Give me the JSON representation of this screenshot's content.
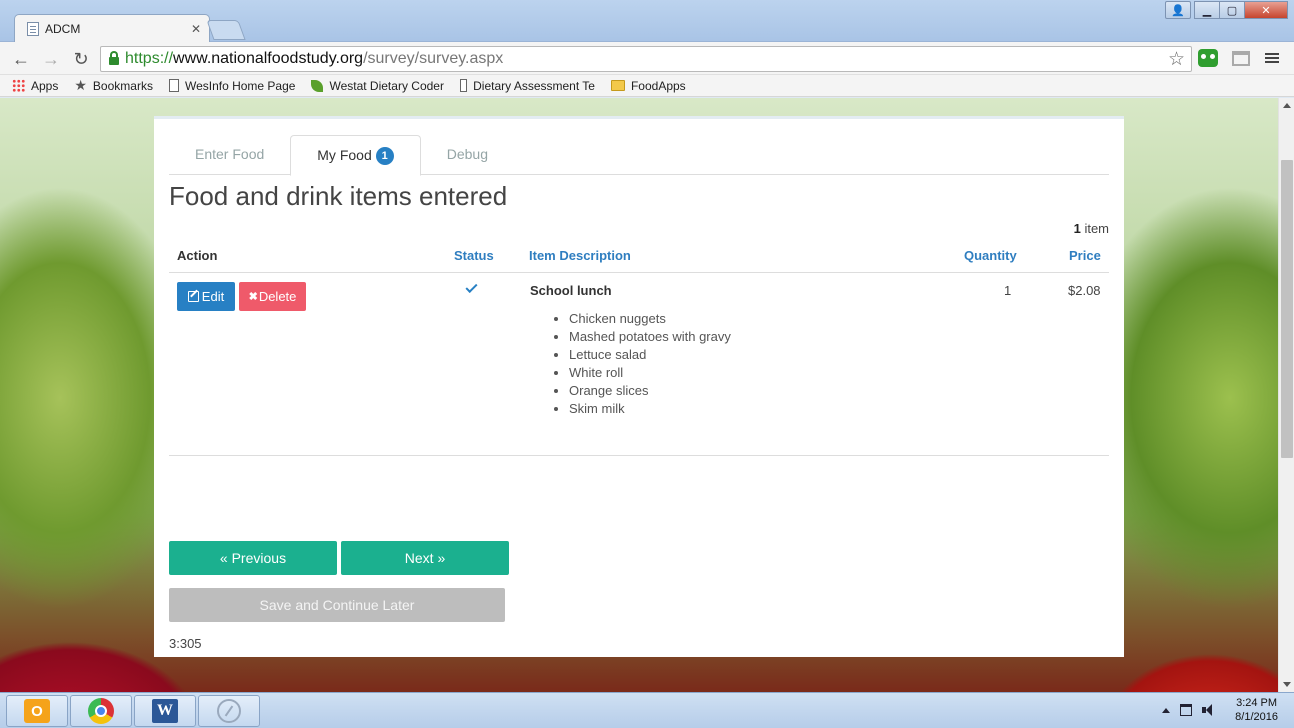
{
  "browser": {
    "tab_title": "ADCM",
    "tab_close": "✕",
    "url_scheme": "https://",
    "url_host": "www.nationalfoodstudy.org",
    "url_path": "/survey/survey.aspx",
    "window_controls": {
      "user": "👤",
      "minimize": "▁",
      "maximize": "▢",
      "close": "✕"
    },
    "nav": {
      "back": "←",
      "forward": "→",
      "reload": "↻",
      "star": "☆"
    },
    "bookmarks": [
      {
        "label": "Apps",
        "icon": "apps-icon"
      },
      {
        "label": "Bookmarks",
        "icon": "star-icon"
      },
      {
        "label": "WesInfo Home Page",
        "icon": "page-icon"
      },
      {
        "label": "Westat Dietary Coder",
        "icon": "leaf-icon"
      },
      {
        "label": "Dietary Assessment Te",
        "icon": "page-icon"
      },
      {
        "label": "FoodApps",
        "icon": "folder-icon"
      }
    ]
  },
  "tabs": [
    {
      "label": "Enter Food",
      "active": false
    },
    {
      "label": "My Food",
      "active": true,
      "badge": "1"
    },
    {
      "label": "Debug",
      "active": false
    }
  ],
  "heading": "Food and drink items entered",
  "item_count": {
    "number": "1",
    "label": "item"
  },
  "table": {
    "headers": {
      "action": "Action",
      "status": "Status",
      "description": "Item Description",
      "quantity": "Quantity",
      "price": "Price"
    },
    "rows": [
      {
        "edit_label": "Edit",
        "delete_label": "Delete",
        "delete_glyph": "✖",
        "status": "completed",
        "title": "School lunch",
        "items": [
          "Chicken nuggets",
          "Mashed potatoes with gravy",
          "Lettuce salad",
          "White roll",
          "Orange slices",
          "Skim milk"
        ],
        "quantity": "1",
        "price": "$2.08"
      }
    ]
  },
  "buttons": {
    "previous": "« Previous",
    "next": "Next »",
    "save": "Save and Continue Later"
  },
  "version": "3:305",
  "taskbar": {
    "apps": [
      "outlook-icon",
      "chrome-icon",
      "word-icon",
      "snipping-tool-icon"
    ],
    "outlook_glyph": "O",
    "word_glyph": "W",
    "time": "3:24 PM",
    "date": "8/1/2016"
  },
  "colors": {
    "primary": "#2780c4",
    "danger": "#ef5a6a",
    "success": "#1bb08f",
    "disabled": "#bdbdbd"
  }
}
